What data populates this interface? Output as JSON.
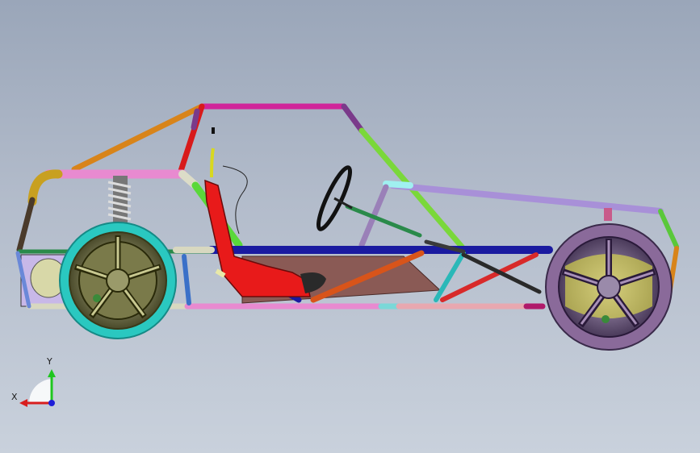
{
  "view": {
    "background_top": "#9aa6b9",
    "background_bottom": "#c9d1dc"
  },
  "triad": {
    "x_label": "X",
    "y_label": "Y",
    "x_color": "#d81e1e",
    "y_color": "#1ec61e",
    "z_color": "#1e1ed8"
  },
  "model": {
    "icons": [
      "roll-cage-frame",
      "front-wheel",
      "rear-wheel",
      "seat",
      "steering-wheel",
      "suspension-spring",
      "coordinate-triad"
    ]
  }
}
